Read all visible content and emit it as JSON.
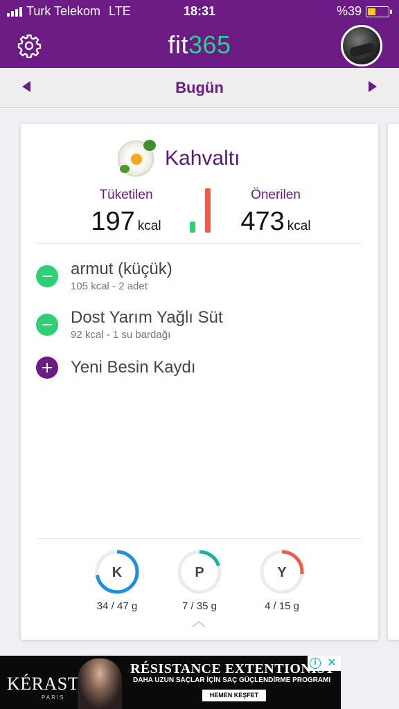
{
  "status_bar": {
    "carrier": "Turk Telekom",
    "network": "LTE",
    "time": "18:31",
    "battery_text": "%39",
    "battery_level": 0.39,
    "signal_bars": 4
  },
  "app_bar": {
    "logo_text": "fit",
    "logo_number": "365",
    "settings_icon": "gear-icon",
    "avatar_icon": "profile-avatar"
  },
  "date_nav": {
    "label": "Bugün",
    "prev_icon": "triangle-left-icon",
    "next_icon": "triangle-right-icon"
  },
  "meal": {
    "title": "Kahvaltı",
    "icon": "breakfast-plate-icon",
    "consumed_label": "Tüketilen",
    "consumed_value": "197",
    "recommended_label": "Önerilen",
    "recommended_value": "473",
    "unit": "kcal",
    "consumed_kcal": 197,
    "recommended_kcal": 473
  },
  "foods": [
    {
      "name": "armut (küçük)",
      "detail": "105 kcal - 2 adet"
    },
    {
      "name": "Dost Yarım Yağlı Süt",
      "detail": "92 kcal - 1 su bardağı"
    }
  ],
  "add_food_label": "Yeni Besin Kaydı",
  "macros": [
    {
      "letter": "K",
      "value": "34 / 47 g",
      "current": 34,
      "target": 47,
      "color": "#1e90e0"
    },
    {
      "letter": "P",
      "value": "7 / 35 g",
      "current": 7,
      "target": 35,
      "color": "#19b39a"
    },
    {
      "letter": "Y",
      "value": "4 / 15 g",
      "current": 4,
      "target": 15,
      "color": "#f25a4c"
    }
  ],
  "ad": {
    "brand": "KÉRASTASE",
    "brand_sub": "PARIS",
    "title": "RÉSISTANCE EXTENTIONIST",
    "subtitle": "DAHA UZUN SAÇLAR İÇİN SAÇ GÜÇLENDİRME PROGRAMI",
    "cta": "HEMEN KEŞFET"
  },
  "colors": {
    "brand_purple": "#6c1a84",
    "green": "#2fcf76",
    "red": "#f25a4c"
  }
}
